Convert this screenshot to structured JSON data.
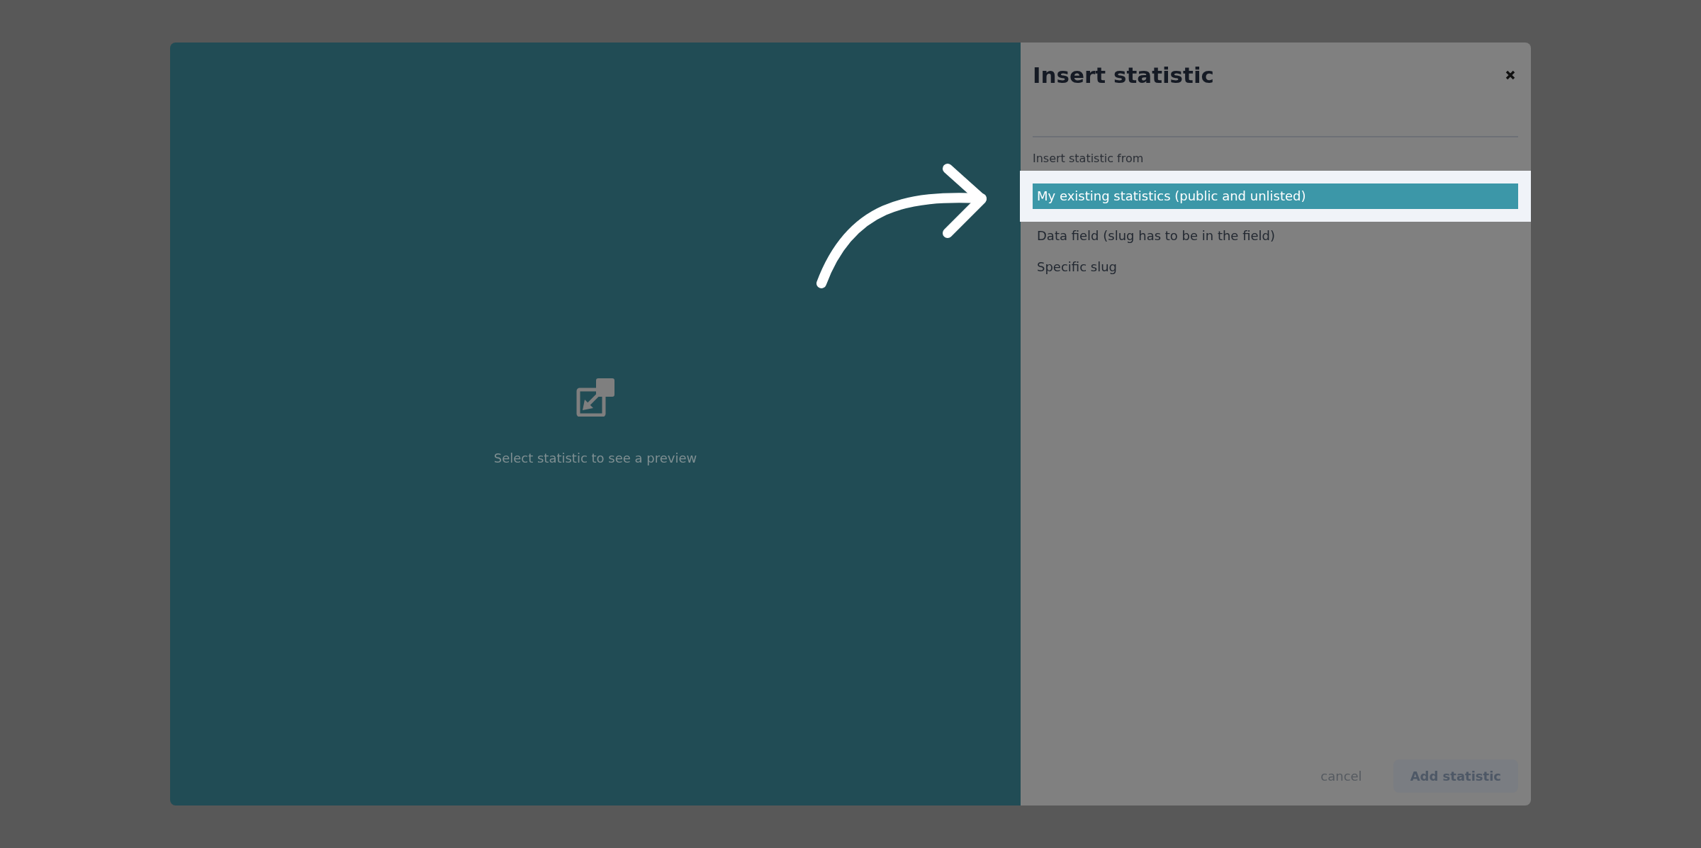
{
  "dialog": {
    "title": "Insert statistic"
  },
  "preview": {
    "message": "Select statistic to see a preview"
  },
  "source": {
    "label": "Insert statistic from",
    "options": [
      {
        "label": "My existing statistics (public and unlisted)",
        "selected": true
      },
      {
        "label": "Data field (slug has to be in the field)",
        "selected": false
      },
      {
        "label": "Specific slug",
        "selected": false
      }
    ]
  },
  "buttons": [
    {
      "label": "cancel",
      "kind": "link"
    },
    {
      "label": "Add statistic",
      "kind": "primary"
    }
  ]
}
